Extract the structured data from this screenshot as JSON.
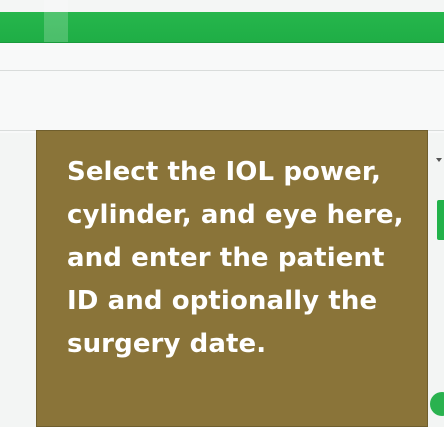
{
  "tooltip": {
    "text": "Select the IOL power, cylinder, and eye here, and enter the patient ID and optionally the surgery date."
  },
  "colors": {
    "header_green": "#22b24a",
    "tooltip_bg": "#8a7439",
    "tooltip_text": "#ffffff",
    "page_bg": "#eef1ef"
  },
  "icons": {
    "dropdown": "caret-down-icon"
  }
}
